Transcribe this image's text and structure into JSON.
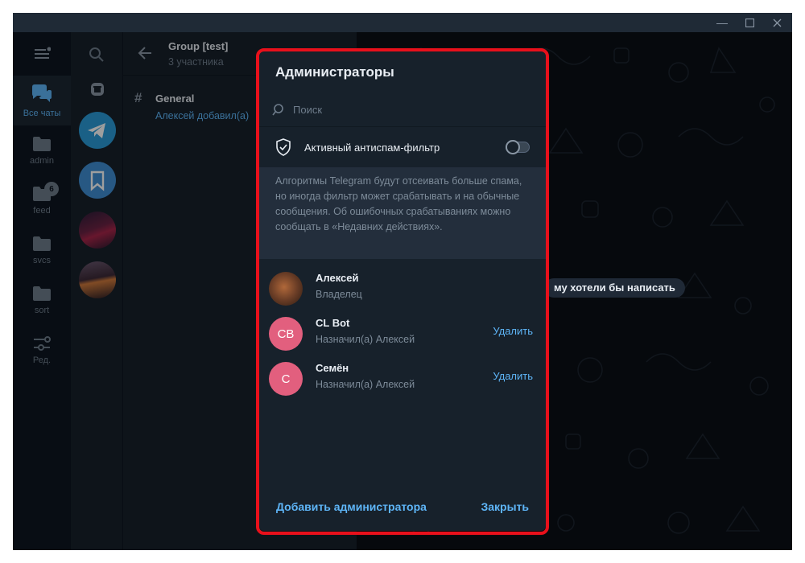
{
  "rail": {
    "items": [
      {
        "label": "Все чаты"
      },
      {
        "label": "admin"
      },
      {
        "label": "feed",
        "badge": "6"
      },
      {
        "label": "svcs"
      },
      {
        "label": "sort"
      },
      {
        "label": "Ред."
      }
    ]
  },
  "chat": {
    "title": "Group [test]",
    "subtitle": "3 участника",
    "topic": {
      "name": "General",
      "preview": "Алексей добавил(а)"
    },
    "banner_text": "му хотели бы написать"
  },
  "dialog": {
    "title": "Администраторы",
    "search_placeholder": "Поиск",
    "antispam_label": "Активный антиспам-фильтр",
    "info_text": "Алгоритмы Telegram будут отсеивать больше спама, но иногда фильтр может срабатывать и на обычные сообщения. Об ошибочных срабатываниях можно сообщать в «Недавних действиях».",
    "admins": [
      {
        "name": "Алексей",
        "role": "Владелец",
        "initials": "",
        "action": ""
      },
      {
        "name": "CL Bot",
        "role": "Назначил(а) Алексей",
        "initials": "CB",
        "action": "Удалить"
      },
      {
        "name": "Семён",
        "role": "Назначил(а) Алексей",
        "initials": "С",
        "action": "Удалить"
      }
    ],
    "add_button": "Добавить администратора",
    "close_button": "Закрыть"
  },
  "colors": {
    "accent": "#5eb5f7",
    "highlight": "#e8101b",
    "avatar_pink": "#e25f7e"
  }
}
